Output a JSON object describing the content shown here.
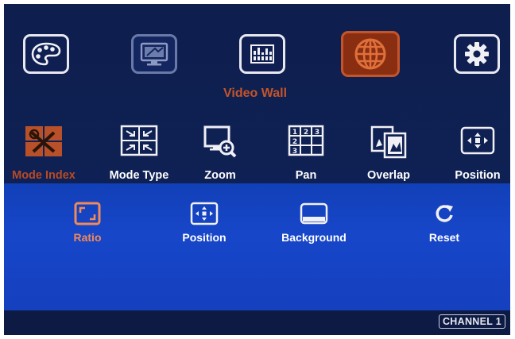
{
  "top_menu": {
    "items": [
      {
        "id": "color",
        "icon": "palette-icon",
        "state": "normal"
      },
      {
        "id": "display",
        "icon": "monitor-icon",
        "state": "dim"
      },
      {
        "id": "audio",
        "icon": "equalizer-icon",
        "state": "normal"
      },
      {
        "id": "video-wall",
        "icon": "globe-icon",
        "state": "active"
      },
      {
        "id": "settings",
        "icon": "gear-icon",
        "state": "normal"
      }
    ],
    "section_title": "Video Wall"
  },
  "submenu": {
    "items": [
      {
        "label": "Mode Index",
        "icon": "grid-tools-icon",
        "active": true
      },
      {
        "label": "Mode Type",
        "icon": "quad-arrows-icon",
        "active": false
      },
      {
        "label": "Zoom",
        "icon": "magnifier-monitor-icon",
        "active": false
      },
      {
        "label": "Pan",
        "icon": "numbered-grid-icon",
        "active": false
      },
      {
        "label": "Overlap",
        "icon": "overlap-frames-icon",
        "active": false
      },
      {
        "label": "Position",
        "icon": "move-arrows-icon",
        "active": false
      }
    ]
  },
  "options": {
    "items": [
      {
        "label": "Ratio",
        "icon": "aspect-corners-icon",
        "active": true
      },
      {
        "label": "Position",
        "icon": "move-arrows-icon",
        "active": false
      },
      {
        "label": "Background",
        "icon": "window-icon",
        "active": false
      },
      {
        "label": "Reset",
        "icon": "reset-icon",
        "active": false
      }
    ]
  },
  "status": {
    "channel": "CHANNEL 1"
  },
  "colors": {
    "background": "#0d1d4a",
    "highlight_panel": "#1746c9",
    "accent": "#c4542a",
    "active_option": "#f08a5a",
    "text": "#ffffff"
  }
}
